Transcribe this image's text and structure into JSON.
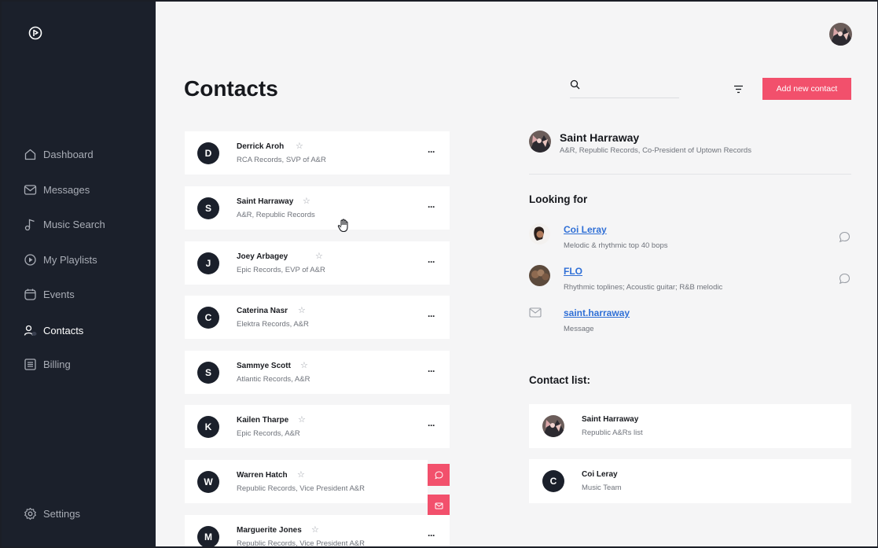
{
  "sidebar": {
    "items": [
      {
        "label": "Dashboard",
        "icon": "home-icon"
      },
      {
        "label": "Messages",
        "icon": "mail-icon"
      },
      {
        "label": "Music Search",
        "icon": "music-note-icon"
      },
      {
        "label": "My Playlists",
        "icon": "play-circle-icon"
      },
      {
        "label": "Events",
        "icon": "calendar-icon"
      },
      {
        "label": "Contacts",
        "icon": "users-icon",
        "active": true
      },
      {
        "label": "Billing",
        "icon": "receipt-icon"
      }
    ],
    "settings_label": "Settings"
  },
  "header": {
    "title": "Contacts",
    "search_placeholder": "",
    "add_button_label": "Add new contact"
  },
  "contacts": [
    {
      "initial": "D",
      "name": "Derrick Aroh",
      "sub": "RCA Records, SVP of A&R"
    },
    {
      "initial": "S",
      "name": "Saint Harraway",
      "sub": "A&R, Republic Records"
    },
    {
      "initial": "J",
      "name": "Joey Arbagey",
      "sub": "Epic Records, EVP of A&R"
    },
    {
      "initial": "C",
      "name": "Caterina Nasr",
      "sub": "Elektra Records, A&R"
    },
    {
      "initial": "S",
      "name": "Sammye Scott",
      "sub": "Atlantic Records, A&R"
    },
    {
      "initial": "K",
      "name": "Kailen Tharpe",
      "sub": "Epic Records, A&R"
    },
    {
      "initial": "W",
      "name": "Warren Hatch",
      "sub": "Republic Records, Vice President A&R"
    },
    {
      "initial": "M",
      "name": "Marguerite Jones",
      "sub": "Republic Records, Vice President A&R"
    }
  ],
  "more_label": "···",
  "star_glyph": "☆",
  "detail": {
    "name": "Saint Harraway",
    "subtitle": "A&R, Republic Records, Co-President of Uptown Records",
    "looking_for_title": "Looking for",
    "looking_for": [
      {
        "name": "Coi Leray",
        "sub": "Melodic & rhythmic top 40 bops"
      },
      {
        "name": "FLO",
        "sub": "Rhythmic toplines; Acoustic guitar; R&B melodic"
      }
    ],
    "email": {
      "label": "saint.harraway",
      "sub": "Message"
    },
    "contact_list_title": "Contact list:",
    "contact_list": [
      {
        "name": "Saint Harraway",
        "sub": "Republic A&Rs list"
      },
      {
        "initial": "C",
        "name": "Coi Leray",
        "sub": "Music Team"
      }
    ]
  },
  "colors": {
    "sidebar_bg": "#1b202b",
    "accent": "#f2506c",
    "link": "#2f6fd6",
    "page_bg": "#f5f5f6"
  }
}
